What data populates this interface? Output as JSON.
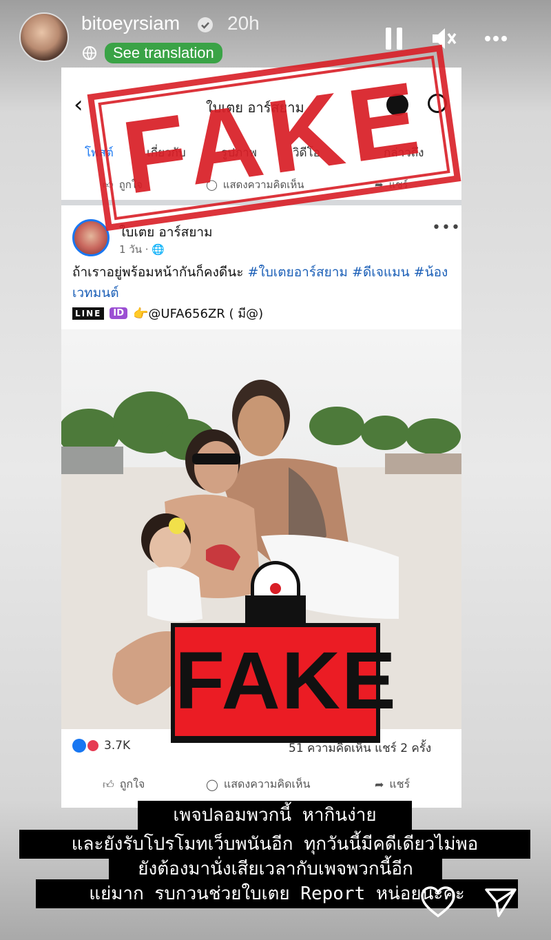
{
  "story": {
    "username": "bitoeyrsiam",
    "time_ago": "20h",
    "see_translation": "See translation"
  },
  "facebook": {
    "page_name": "ใบเตย อาร์สยาม",
    "tabs": [
      "โพสต์",
      "เกี่ยวกับ",
      "รูปภาพ",
      "วิดีโอ",
      "กล่าวถึง"
    ],
    "top_actions": [
      "ถูกใจ",
      "แสดงความคิดเห็น",
      "แชร์"
    ],
    "post": {
      "author": "ใบเตย อาร์สยาม",
      "time": "1 วัน · 🌐",
      "text_plain": "ถ้าเราอยู่พร้อมหน้ากันก็คงดีนะ ",
      "hashtags": "#ใบเตยอาร์สยาม #ดีเจแมน #น้องเวทมนต์",
      "line_logo": "LINE",
      "id_badge": "ID",
      "line_contact": "👉@UFA656ZR ( มี@)",
      "reaction_count": "3.7K",
      "comments_shares": "51 ความคิดเห็น  แชร์ 2 ครั้ง",
      "bottom_actions": [
        "ถูกใจ",
        "แสดงความคิดเห็น",
        "แชร์"
      ]
    }
  },
  "stamps": {
    "top": "FAKE",
    "badge": "FAKE"
  },
  "caption": [
    "เพจปลอมพวกนี้  หากินง่าย",
    "และยังรับโปรโมทเว็บพนันอีก  ทุกวันนี้มีคดีเดียวไม่พอ",
    "ยังต้องมานั่งเสียเวลากับเพจพวกนี้อีก",
    "แย่มาก  รบกวนช่วยใบเตย  Report  หน่อยนะคะ"
  ],
  "colors": {
    "stamp_red": "#d81e26",
    "fb_blue": "#1877f2",
    "verified_blue": "#3897f0"
  }
}
